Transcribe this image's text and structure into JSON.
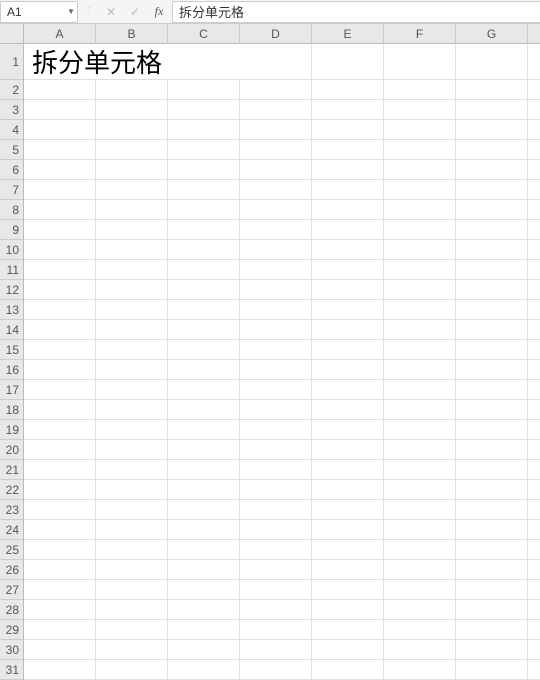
{
  "formula_bar": {
    "name_box_value": "A1",
    "cancel_icon": "✕",
    "enter_icon": "✓",
    "fx_label": "fx",
    "formula_value": "拆分单元格"
  },
  "columns": [
    "A",
    "B",
    "C",
    "D",
    "E",
    "F",
    "G"
  ],
  "rows": [
    "1",
    "2",
    "3",
    "4",
    "5",
    "6",
    "7",
    "8",
    "9",
    "10",
    "11",
    "12",
    "13",
    "14",
    "15",
    "16",
    "17",
    "18",
    "19",
    "20",
    "21",
    "22",
    "23",
    "24",
    "25",
    "26",
    "27",
    "28",
    "29",
    "30",
    "31"
  ],
  "cells": {
    "A1_merged": "拆分单元格"
  }
}
